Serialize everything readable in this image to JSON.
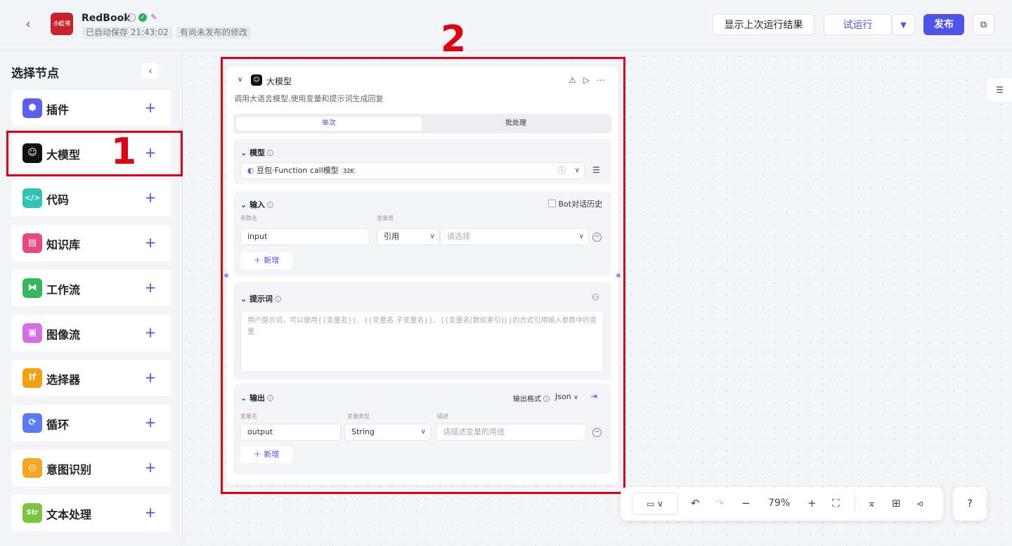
{
  "header": {
    "back_icon": "chevron-left",
    "logo_text": "小红书",
    "app_name": "RedBook",
    "autosave": "已自动保存 21:43:02",
    "unpublished": "有尚未发布的修改",
    "show_last_result": "显示上次运行结果",
    "test_run": "试运行",
    "publish": "发布"
  },
  "sidebar": {
    "title": "选择节点",
    "items": [
      {
        "label": "插件",
        "icon": "plugin-icon",
        "color": "#5b5ff2"
      },
      {
        "label": "大模型",
        "icon": "llm-icon",
        "color": "#111111"
      },
      {
        "label": "代码",
        "icon": "code-icon",
        "color": "#2ec4b6"
      },
      {
        "label": "知识库",
        "icon": "knowledge-icon",
        "color": "#e8487d"
      },
      {
        "label": "工作流",
        "icon": "workflow-icon",
        "color": "#35b85a"
      },
      {
        "label": "图像流",
        "icon": "imageflow-icon",
        "color": "#d86ee6"
      },
      {
        "label": "选择器",
        "icon": "selector-icon",
        "color": "#f5a00f"
      },
      {
        "label": "循环",
        "icon": "loop-icon",
        "color": "#5b7bf2"
      },
      {
        "label": "意图识别",
        "icon": "intent-icon",
        "color": "#f5a623"
      },
      {
        "label": "文本处理",
        "icon": "text-icon",
        "color": "#7cc63f"
      }
    ]
  },
  "annotations": {
    "one": "1",
    "two": "2"
  },
  "node": {
    "title": "大模型",
    "description": "调用大语言模型,使用变量和提示词生成回复",
    "tab_single": "单次",
    "tab_batch": "批处理",
    "model": {
      "label": "模型",
      "selected": "豆包·Function call模型",
      "badge": "32K"
    },
    "input": {
      "label": "输入",
      "bot_history": "Bot对话历史",
      "col_param": "参数名",
      "col_value": "变量值",
      "param_value": "input",
      "ref_type": "引用",
      "select_placeholder": "请选择",
      "add": "新增"
    },
    "prompt": {
      "label": "提示词",
      "placeholder": "用户提示词，可以使用{{变量名}}、{{变量名.子变量名}}、{{变量名[数组索引]}}的方式引用输入参数中的变量"
    },
    "output": {
      "label": "输出",
      "format_label": "输出格式",
      "format": "Json",
      "col_name": "变量名",
      "col_type": "变量类型",
      "col_desc": "描述",
      "var_name": "output",
      "var_type": "String",
      "desc_placeholder": "请描述变量的用途",
      "add": "新增"
    }
  },
  "toolbar": {
    "zoom": "79%"
  }
}
